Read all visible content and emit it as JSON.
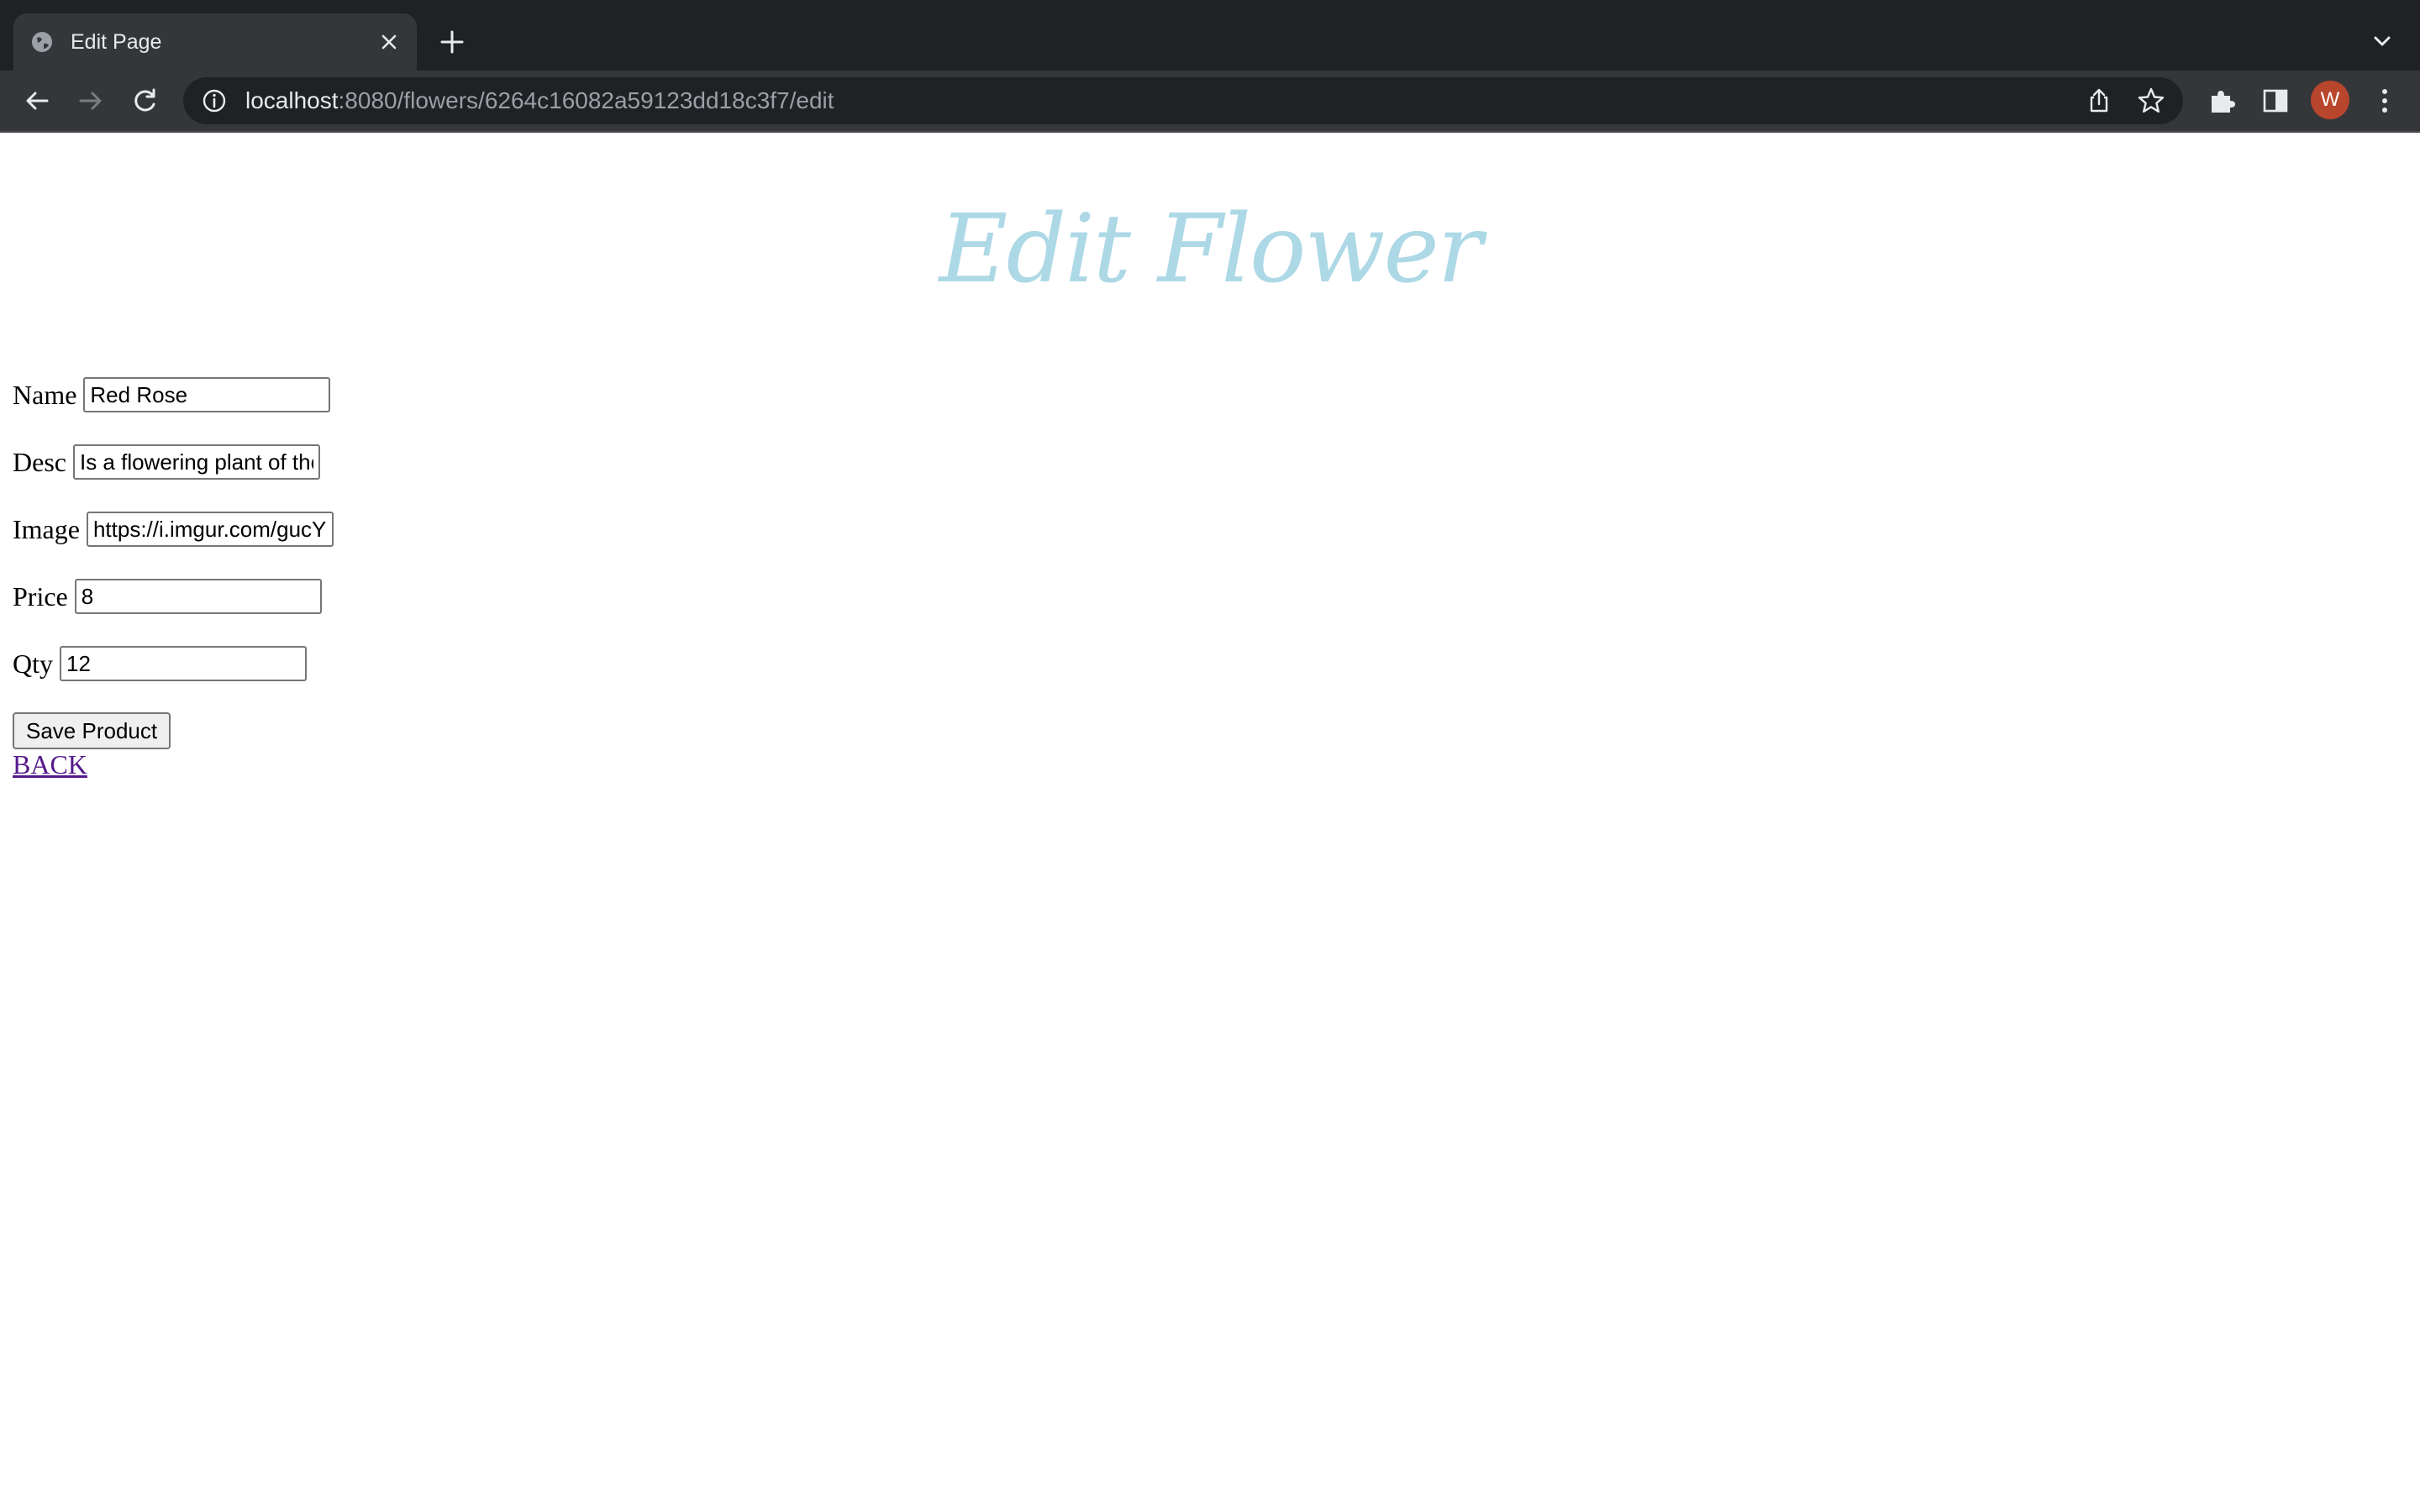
{
  "browser": {
    "tab_title": "Edit Page",
    "url_host": "localhost",
    "url_path": ":8080/flowers/6264c16082a59123dd18c3f7/edit",
    "profile_initial": "W"
  },
  "page": {
    "title": "Edit Flower",
    "fields": {
      "name": {
        "label": "Name",
        "value": "Red Rose"
      },
      "desc": {
        "label": "Desc",
        "value": "Is a flowering plant of the"
      },
      "image": {
        "label": "Image",
        "value": "https://i.imgur.com/gucY"
      },
      "price": {
        "label": "Price",
        "value": "8"
      },
      "qty": {
        "label": "Qty",
        "value": "12"
      }
    },
    "save_label": "Save Product",
    "back_label": "BACK"
  },
  "colors": {
    "title": "#add8e6",
    "visited_link": "#551a8b",
    "avatar": "#b8462c"
  }
}
